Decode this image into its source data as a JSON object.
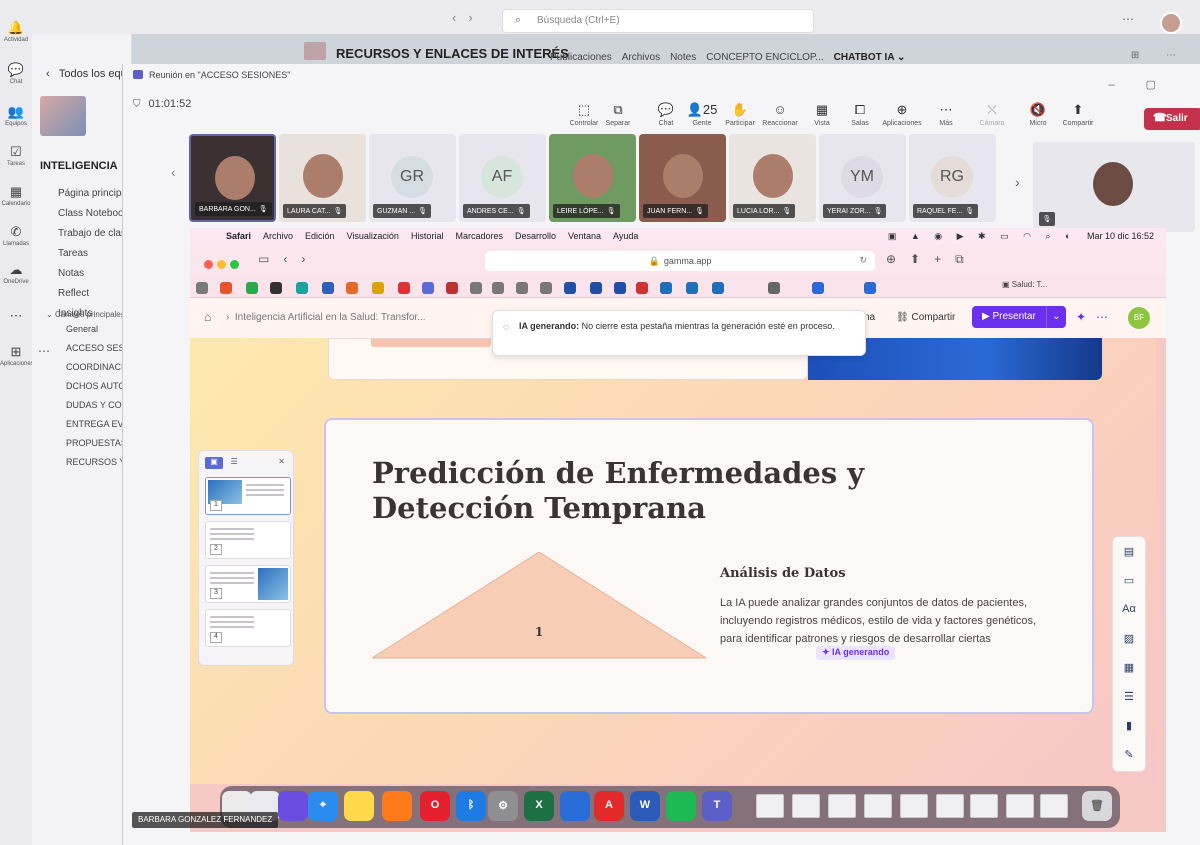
{
  "teams": {
    "rail": [
      {
        "icon": "bell-icon",
        "glyph": "🔔",
        "label": "Actividad"
      },
      {
        "icon": "chat-icon",
        "glyph": "💬",
        "label": "Chat"
      },
      {
        "icon": "teams-icon",
        "glyph": "👥",
        "label": "Equipos"
      },
      {
        "icon": "tasks-icon",
        "glyph": "☑",
        "label": "Tareas"
      },
      {
        "icon": "calendar-icon",
        "glyph": "▦",
        "label": "Calendario"
      },
      {
        "icon": "calls-icon",
        "glyph": "✆",
        "label": "Llamadas"
      },
      {
        "icon": "onedrive-icon",
        "glyph": "☁",
        "label": "OneDrive"
      },
      {
        "icon": "more-icon",
        "glyph": "⋯",
        "label": ""
      },
      {
        "icon": "apps-icon",
        "glyph": "⊞",
        "label": "Aplicaciones"
      }
    ],
    "search_placeholder": "Búsqueda (Ctrl+E)",
    "back_label": "Todos los equipos",
    "team_name": "INTELIGENCIA",
    "team_menu": [
      "Página principal",
      "Class Notebook",
      "Trabajo de clase",
      "Tareas",
      "Notas",
      "Reflect",
      "Insights"
    ],
    "channels_header": "Canales principales",
    "channels": [
      "General",
      "ACCESO SESIONES",
      "COORDINACIÓN",
      "DCHOS AUTOR",
      "DUDAS Y CONSULTAS",
      "ENTREGA EVIDENCIAS",
      "PROPUESTAS",
      "RECURSOS Y ENLACES"
    ],
    "channel_title": "RECURSOS Y ENLACES DE INTERÉS",
    "channel_tabs": [
      "Publicaciones",
      "Archivos",
      "Notes",
      "CONCEPTO ENCICLOP...",
      "CHATBOT IA ⌄"
    ]
  },
  "meeting": {
    "title": "Reunión en \"ACCESO SESIONES\"",
    "timer": "01:01:52",
    "tools": [
      {
        "label": "Controlar",
        "icon": "control-icon",
        "glyph": "⬚",
        "enabled": true
      },
      {
        "label": "Separar",
        "icon": "popout-icon",
        "glyph": "⧉",
        "enabled": true
      },
      {
        "label": "Chat",
        "icon": "chat-icon",
        "glyph": "💬",
        "enabled": true
      },
      {
        "label": "Gente",
        "icon": "people-icon",
        "glyph": "👤25",
        "enabled": true
      },
      {
        "label": "Participar",
        "icon": "raise-hand-icon",
        "glyph": "✋",
        "enabled": true
      },
      {
        "label": "Reaccionar",
        "icon": "react-icon",
        "glyph": "☺",
        "enabled": true
      },
      {
        "label": "Vista",
        "icon": "view-icon",
        "glyph": "▦",
        "enabled": true
      },
      {
        "label": "Salas",
        "icon": "rooms-icon",
        "glyph": "⧠",
        "enabled": true
      },
      {
        "label": "Aplicaciones",
        "icon": "apps-icon",
        "glyph": "⊕",
        "enabled": true
      },
      {
        "label": "Más",
        "icon": "more-icon",
        "glyph": "⋯",
        "enabled": true
      },
      {
        "label": "Cámara",
        "icon": "camera-off-icon",
        "glyph": "⛌",
        "enabled": false
      },
      {
        "label": "Micro",
        "icon": "mic-icon",
        "glyph": "🔇",
        "enabled": true
      },
      {
        "label": "Compartir",
        "icon": "share-icon",
        "glyph": "⬆",
        "enabled": true
      }
    ],
    "leave_label": "Salir",
    "participants": [
      {
        "name": "BARBARA GON...",
        "initials": "",
        "photo": true,
        "color": "#3b3132"
      },
      {
        "name": "LAURA CAT...",
        "initials": "",
        "photo": true,
        "color": "#e9e1dc"
      },
      {
        "name": "GUZMAN ...",
        "initials": "GR",
        "photo": false,
        "color": "#d5dde3"
      },
      {
        "name": "ANDRES CE...",
        "initials": "AF",
        "photo": false,
        "color": "#d6e6dc"
      },
      {
        "name": "LEIRE LÓPE...",
        "initials": "",
        "photo": true,
        "color": "#6f9b63"
      },
      {
        "name": "JUAN FERN...",
        "initials": "",
        "photo": true,
        "color": "#8b5b4e"
      },
      {
        "name": "LUCIA LOR...",
        "initials": "",
        "photo": true,
        "color": "#e9e4e0"
      },
      {
        "name": "YERAI ZOR...",
        "initials": "YM",
        "photo": false,
        "color": "#dedbe6"
      },
      {
        "name": "RAQUEL FE...",
        "initials": "RG",
        "photo": false,
        "color": "#e5dcd8"
      }
    ],
    "presenter_name": "BARBARA GONZALEZ FERNANDEZ"
  },
  "mac": {
    "menus": [
      "Safari",
      "Archivo",
      "Edición",
      "Visualización",
      "Historial",
      "Marcadores",
      "Desarrollo",
      "Ventana",
      "Ayuda"
    ],
    "clock": "Mar 10 dic  16:52",
    "url": "gamma.app",
    "fav_tab_label": "Salud: T..."
  },
  "gamma": {
    "breadcrumb": "Inteligencia Artificial en la Salud: Transfor...",
    "na_label": "na",
    "share_label": "Compartir",
    "present_label": "Presentar",
    "avatar_initials": "BF",
    "toast_title": "IA generando:",
    "toast_text": "No cierre esta pestaña mientras la generación esté en proceso.",
    "slide_title": "Predicción de Enfermedades y Detección Temprana",
    "pyramid_label": "1",
    "section_title": "Análisis de Datos",
    "section_body": "La IA puede analizar grandes conjuntos de datos de pacientes, incluyendo registros médicos, estilo de vida y factores genéticos, para identificar patrones y riesgos de desarrollar ciertas",
    "ia_chip": "✦ IA generando",
    "thumbnails": [
      "1",
      "2",
      "3",
      "4"
    ],
    "help_label": "?"
  }
}
